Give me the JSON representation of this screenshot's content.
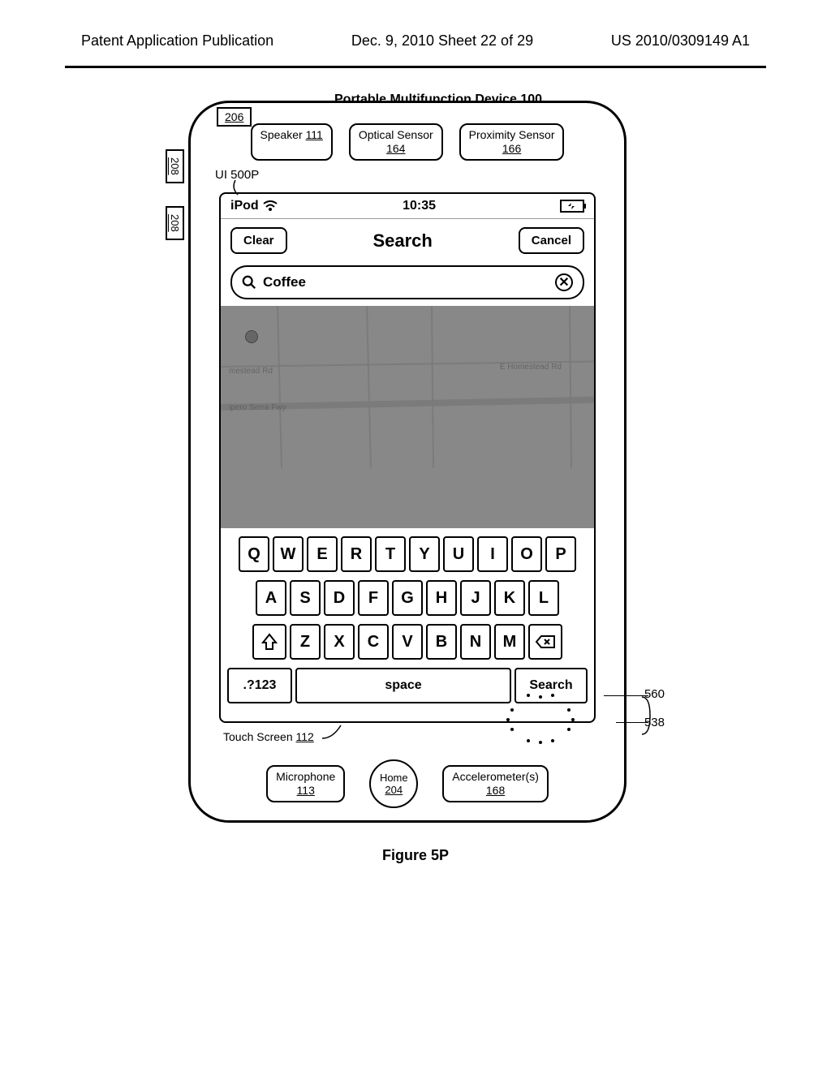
{
  "page_header": {
    "left": "Patent Application Publication",
    "center": "Dec. 9, 2010   Sheet 22 of 29",
    "right": "US 2010/0309149 A1"
  },
  "device_title": "Portable Multifunction Device 100",
  "labels": {
    "l206": "206",
    "l208": "208",
    "ui500p": "UI 500P",
    "speaker": "Speaker ",
    "speaker_num": "111",
    "optical": "Optical Sensor ",
    "optical_num": "164",
    "proximity": "Proximity Sensor ",
    "proximity_num": "166",
    "touch_screen": "Touch Screen ",
    "touch_screen_num": "112",
    "microphone": "Microphone",
    "microphone_num": "113",
    "home": "Home",
    "home_num": "204",
    "accelerometer": "Accelerometer(s)",
    "accelerometer_num": "168",
    "callout_560": "560",
    "callout_538": "538"
  },
  "status_bar": {
    "carrier": "iPod",
    "time": "10:35"
  },
  "nav_bar": {
    "clear": "Clear",
    "title": "Search",
    "cancel": "Cancel"
  },
  "search": {
    "value": "Coffee"
  },
  "map": {
    "road1": "E Homestead Rd",
    "road2": "mestead Rd",
    "road3": "ipero Serra Fwy"
  },
  "keyboard": {
    "row1": [
      "Q",
      "W",
      "E",
      "R",
      "T",
      "Y",
      "U",
      "I",
      "O",
      "P"
    ],
    "row2": [
      "A",
      "S",
      "D",
      "F",
      "G",
      "H",
      "J",
      "K",
      "L"
    ],
    "row3": [
      "Z",
      "X",
      "C",
      "V",
      "B",
      "N",
      "M"
    ],
    "numkey": ".?123",
    "space": "space",
    "search": "Search"
  },
  "figure_caption": "Figure 5P"
}
